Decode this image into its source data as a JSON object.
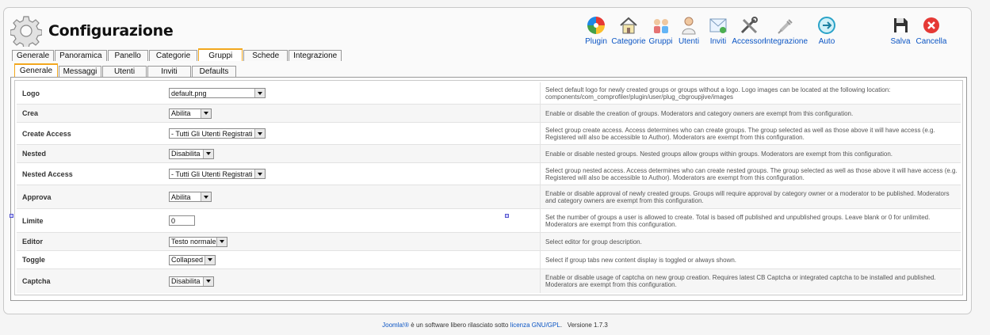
{
  "header": {
    "title": "Configurazione",
    "icon": "gear-icon"
  },
  "toolbar": {
    "plugin": "Plugin",
    "categorie": "Categorie",
    "gruppi": "Gruppi",
    "utenti": "Utenti",
    "inviti": "Inviti",
    "accessori": "Accessori",
    "integrazione": "Integrazione",
    "auto": "Auto",
    "salva": "Salva",
    "cancella": "Cancella"
  },
  "main_tabs": {
    "generale": "Generale",
    "panoramica": "Panoramica",
    "panello": "Panello",
    "categorie": "Categorie",
    "gruppi": "Gruppi",
    "schede": "Schede",
    "integrazione": "Integrazione",
    "active": "Gruppi"
  },
  "sub_tabs": {
    "generale": "Generale",
    "messaggi": "Messaggi",
    "utenti": "Utenti",
    "inviti": "Inviti",
    "defaults": "Defaults",
    "active": "Generale"
  },
  "rows": {
    "logo": {
      "label": "Logo",
      "value": "default.png",
      "desc": "Select default logo for newly created groups or groups without a logo. Logo images can be located at the following location: components/com_comprofiler/plugin/user/plug_cbgroupjive/images"
    },
    "crea": {
      "label": "Crea",
      "value": "Abilita",
      "desc": "Enable or disable the creation of groups. Moderators and category owners are exempt from this configuration."
    },
    "create_access": {
      "label": "Create Access",
      "value": "- Tutti Gli Utenti Registrati",
      "desc": "Select group create access. Access determines who can create groups. The group selected as well as those above it will have access (e.g. Registered will also be accessible to Author). Moderators are exempt from this configuration."
    },
    "nested": {
      "label": "Nested",
      "value": "Disabilita",
      "desc": "Enable or disable nested groups. Nested groups allow groups within groups. Moderators are exempt from this configuration."
    },
    "nested_access": {
      "label": "Nested Access",
      "value": "- Tutti Gli Utenti Registrati",
      "desc": "Select group nested access. Access determines who can create nested groups. The group selected as well as those above it will have access (e.g. Registered will also be accessible to Author). Moderators are exempt from this configuration."
    },
    "approva": {
      "label": "Approva",
      "value": "Abilita",
      "desc": "Enable or disable approval of newly created groups. Groups will require approval by category owner or a moderator to be published. Moderators and category owners are exempt from this configuration."
    },
    "limite": {
      "label": "Limite",
      "value": "0",
      "desc": "Set the number of groups a user is allowed to create. Total is based off published and unpublished groups. Leave blank or 0 for unlimited. Moderators are exempt from this configuration."
    },
    "editor": {
      "label": "Editor",
      "value": "Testo normale",
      "desc": "Select editor for group description."
    },
    "toggle": {
      "label": "Toggle",
      "value": "Collapsed",
      "desc": "Select if group tabs new content display is toggled or always shown."
    },
    "captcha": {
      "label": "Captcha",
      "value": "Disabilita",
      "desc": "Enable or disable usage of captcha on new group creation. Requires latest CB Captcha or integrated captcha to be installed and published. Moderators are exempt from this configuration."
    }
  },
  "footer": {
    "joomla": "Joomla!®",
    "text1": " è un software libero rilasciato sotto ",
    "license": "licenza GNU/GPL",
    "text2": ".   Versione 1.7.3"
  }
}
